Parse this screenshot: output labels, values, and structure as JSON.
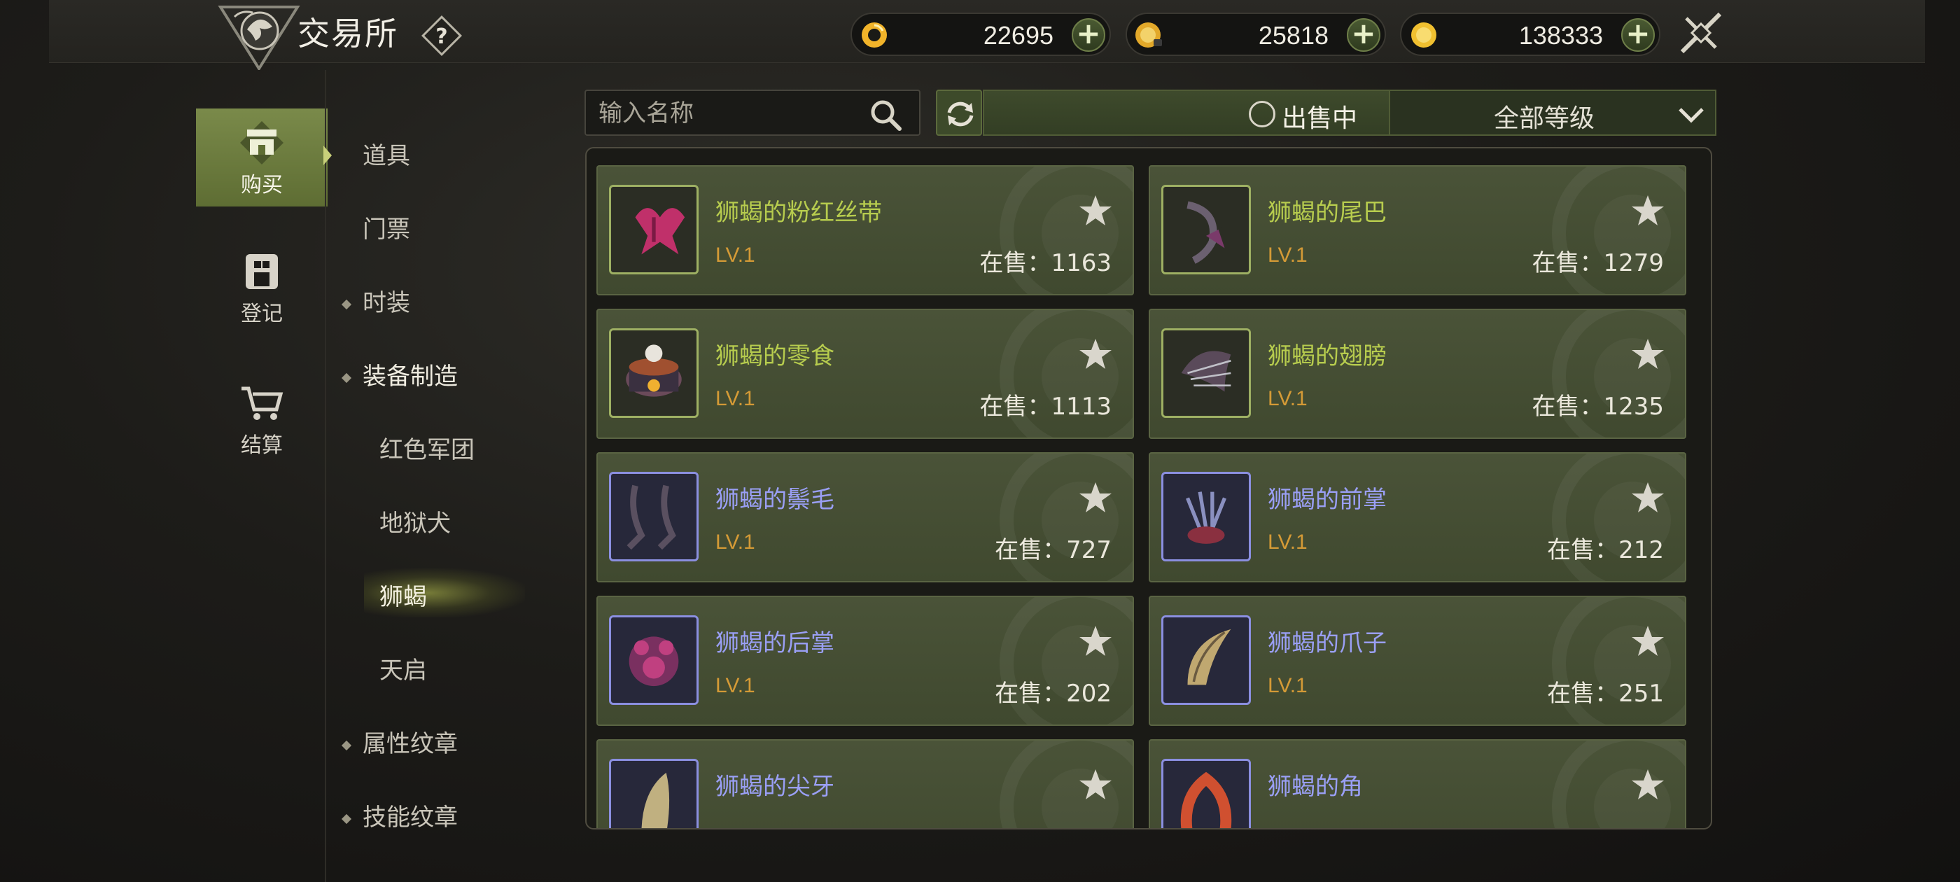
{
  "header": {
    "title": "交易所",
    "currencies": [
      {
        "name": "gold-coin-ring",
        "value": "22695",
        "icon": "ring-coin-icon",
        "color": "#f2b42a"
      },
      {
        "name": "locked-gold",
        "value": "25818",
        "icon": "locked-coin-icon",
        "color": "#e3a92a"
      },
      {
        "name": "gold",
        "value": "138333",
        "icon": "gold-coin-icon",
        "color": "#f0c030"
      }
    ]
  },
  "leftnav": {
    "items": [
      {
        "label": "购买",
        "icon": "shop-icon",
        "active": true
      },
      {
        "label": "登记",
        "icon": "register-icon",
        "active": false
      },
      {
        "label": "结算",
        "icon": "cart-icon",
        "active": false
      }
    ]
  },
  "categories": [
    {
      "label": "道具",
      "level": 0,
      "diamond": false
    },
    {
      "label": "门票",
      "level": 0,
      "diamond": false
    },
    {
      "label": "时装",
      "level": 0,
      "diamond": true
    },
    {
      "label": "装备制造",
      "level": 0,
      "diamond": true
    },
    {
      "label": "红色军团",
      "level": 1,
      "diamond": false
    },
    {
      "label": "地狱犬",
      "level": 1,
      "diamond": false
    },
    {
      "label": "狮蝎",
      "level": 1,
      "diamond": false,
      "selected": true
    },
    {
      "label": "天启",
      "level": 1,
      "diamond": false
    },
    {
      "label": "属性纹章",
      "level": 0,
      "diamond": true
    },
    {
      "label": "技能纹章",
      "level": 0,
      "diamond": true
    }
  ],
  "search": {
    "placeholder": "输入名称",
    "value": ""
  },
  "filter": {
    "on_sale_label": "出售中",
    "level_select": "全部等级"
  },
  "items": [
    {
      "name": "狮蝎的粉红丝带",
      "lv": "LV.1",
      "sale": "在售：1163",
      "rarity": "green"
    },
    {
      "name": "狮蝎的尾巴",
      "lv": "LV.1",
      "sale": "在售：1279",
      "rarity": "green"
    },
    {
      "name": "狮蝎的零食",
      "lv": "LV.1",
      "sale": "在售：1113",
      "rarity": "green"
    },
    {
      "name": "狮蝎的翅膀",
      "lv": "LV.1",
      "sale": "在售：1235",
      "rarity": "green"
    },
    {
      "name": "狮蝎的鬃毛",
      "lv": "LV.1",
      "sale": "在售：727",
      "rarity": "blue"
    },
    {
      "name": "狮蝎的前掌",
      "lv": "LV.1",
      "sale": "在售：212",
      "rarity": "blue"
    },
    {
      "name": "狮蝎的后掌",
      "lv": "LV.1",
      "sale": "在售：202",
      "rarity": "blue"
    },
    {
      "name": "狮蝎的爪子",
      "lv": "LV.1",
      "sale": "在售：251",
      "rarity": "blue"
    },
    {
      "name": "狮蝎的尖牙",
      "lv": "",
      "sale": "",
      "rarity": "blue"
    },
    {
      "name": "狮蝎的角",
      "lv": "",
      "sale": "",
      "rarity": "blue"
    }
  ]
}
